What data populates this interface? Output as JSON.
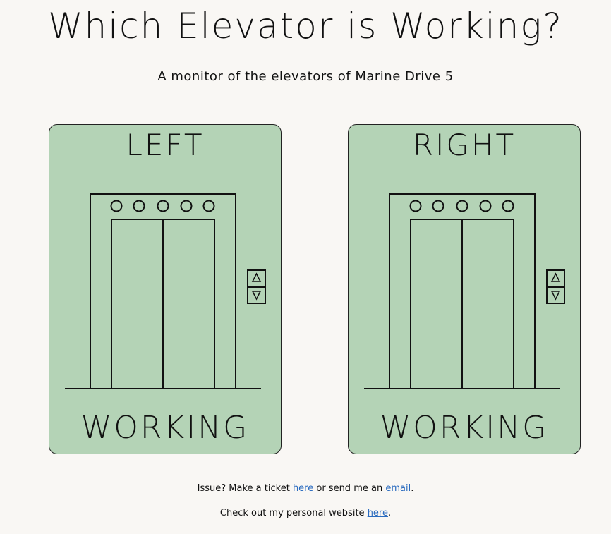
{
  "header": {
    "title": "Which Elevator is Working?",
    "subtitle": "A monitor of the elevators of Marine Drive 5"
  },
  "elevators": [
    {
      "name": "LEFT",
      "status": "WORKING",
      "color": "#b4d3b6"
    },
    {
      "name": "RIGHT",
      "status": "WORKING",
      "color": "#b4d3b6"
    }
  ],
  "footer": {
    "line1_prefix": "Issue? Make a ticket ",
    "ticket_link": "here",
    "line1_middle": " or send me an ",
    "email_link": "email",
    "line1_suffix": ".",
    "line2_prefix": "Check out my personal website ",
    "website_link": "here",
    "line2_suffix": "."
  },
  "colors": {
    "background": "#f9f7f4",
    "card": "#b4d3b6",
    "link": "#2a6bbf"
  }
}
